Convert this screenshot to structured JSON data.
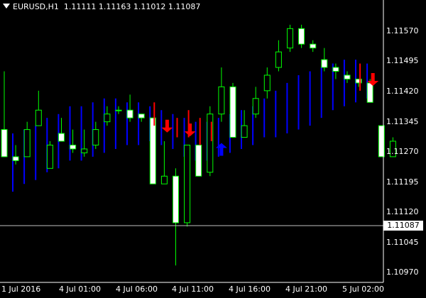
{
  "header": {
    "symbol_tf": "EURUSD,H1",
    "ohlc": "1.11111 1.11163 1.11012 1.11087"
  },
  "y_axis": {
    "labels": [
      "1.11570",
      "1.11495",
      "1.11420",
      "1.11345",
      "1.11270",
      "1.11195",
      "1.11120",
      "1.11045",
      "1.10970"
    ]
  },
  "current_price": "1.11087",
  "x_axis": {
    "labels": [
      "1 Jul 2016",
      "4 Jul 01:00",
      "4 Jul 06:00",
      "4 Jul 11:00",
      "4 Jul 16:00",
      "4 Jul 21:00",
      "5 Jul 02:00"
    ]
  },
  "colors": {
    "background": "#000000",
    "bull_border": "#00ff00",
    "bull_fill": "#000000",
    "bear_border": "#00ff00",
    "bear_fill": "#ffffff",
    "indicator": "#0000ff",
    "sell_arrow": "#ff0000",
    "buy_arrow": "#0000ff",
    "price_line": "#c0c0c0"
  },
  "chart_data": {
    "type": "candlestick",
    "ylim": [
      1.1094,
      1.1166
    ],
    "candles": [
      {
        "o": 1.1133,
        "h": 1.1148,
        "l": 1.1126,
        "c": 1.1126
      },
      {
        "o": 1.1126,
        "h": 1.1129,
        "l": 1.1124,
        "c": 1.1125
      },
      {
        "o": 1.1126,
        "h": 1.1135,
        "l": 1.1126,
        "c": 1.1133
      },
      {
        "o": 1.1134,
        "h": 1.1143,
        "l": 1.1134,
        "c": 1.1138
      },
      {
        "o": 1.1123,
        "h": 1.113,
        "l": 1.1123,
        "c": 1.1129
      },
      {
        "o": 1.1132,
        "h": 1.1136,
        "l": 1.113,
        "c": 1.113
      },
      {
        "o": 1.1129,
        "h": 1.1133,
        "l": 1.1127,
        "c": 1.1128
      },
      {
        "o": 1.1127,
        "h": 1.1133,
        "l": 1.1126,
        "c": 1.1128
      },
      {
        "o": 1.1129,
        "h": 1.1135,
        "l": 1.1128,
        "c": 1.1133
      },
      {
        "o": 1.1135,
        "h": 1.1139,
        "l": 1.1134,
        "c": 1.1137
      },
      {
        "o": 1.1138,
        "h": 1.1139,
        "l": 1.1137,
        "c": 1.1138
      },
      {
        "o": 1.1138,
        "h": 1.1142,
        "l": 1.1135,
        "c": 1.1136
      },
      {
        "o": 1.1137,
        "h": 1.1137,
        "l": 1.1135,
        "c": 1.1136
      },
      {
        "o": 1.1136,
        "h": 1.1136,
        "l": 1.1119,
        "c": 1.1119
      },
      {
        "o": 1.1119,
        "h": 1.113,
        "l": 1.1119,
        "c": 1.1121
      },
      {
        "o": 1.1121,
        "h": 1.1123,
        "l": 1.1098,
        "c": 1.1109
      },
      {
        "o": 1.1109,
        "h": 1.1129,
        "l": 1.1108,
        "c": 1.1129
      },
      {
        "o": 1.1129,
        "h": 1.1129,
        "l": 1.1121,
        "c": 1.1121
      },
      {
        "o": 1.1122,
        "h": 1.1139,
        "l": 1.1121,
        "c": 1.1137
      },
      {
        "o": 1.1137,
        "h": 1.1149,
        "l": 1.1135,
        "c": 1.1144
      },
      {
        "o": 1.1144,
        "h": 1.1145,
        "l": 1.1131,
        "c": 1.1131
      },
      {
        "o": 1.1131,
        "h": 1.1138,
        "l": 1.1131,
        "c": 1.1134
      },
      {
        "o": 1.1137,
        "h": 1.1144,
        "l": 1.1136,
        "c": 1.1141
      },
      {
        "o": 1.1143,
        "h": 1.1149,
        "l": 1.1141,
        "c": 1.1147
      },
      {
        "o": 1.1149,
        "h": 1.1156,
        "l": 1.1148,
        "c": 1.1153
      },
      {
        "o": 1.1154,
        "h": 1.116,
        "l": 1.1153,
        "c": 1.1159
      },
      {
        "o": 1.1159,
        "h": 1.116,
        "l": 1.1154,
        "c": 1.1155
      },
      {
        "o": 1.1155,
        "h": 1.1156,
        "l": 1.1153,
        "c": 1.1154
      },
      {
        "o": 1.1151,
        "h": 1.1154,
        "l": 1.1148,
        "c": 1.1149
      },
      {
        "o": 1.1149,
        "h": 1.115,
        "l": 1.1146,
        "c": 1.1148
      },
      {
        "o": 1.1147,
        "h": 1.1148,
        "l": 1.1145,
        "c": 1.1146
      },
      {
        "o": 1.1146,
        "h": 1.1146,
        "l": 1.1144,
        "c": 1.1145
      },
      {
        "o": 1.1145,
        "h": 1.1146,
        "l": 1.114,
        "c": 1.114
      },
      {
        "o": 1.1134,
        "h": 1.1134,
        "l": 1.1126,
        "c": 1.1126
      },
      {
        "o": 1.1126,
        "h": 1.1131,
        "l": 1.1126,
        "c": 1.113
      }
    ],
    "indicator": [
      {
        "high": 1.1132,
        "low": 1.1117
      },
      {
        "high": 1.1133,
        "low": 1.1119
      },
      {
        "high": 1.1134,
        "low": 1.112
      },
      {
        "high": 1.1136,
        "low": 1.1122
      },
      {
        "high": 1.1137,
        "low": 1.1123
      },
      {
        "high": 1.1139,
        "low": 1.1125
      },
      {
        "high": 1.1139,
        "low": 1.1125
      },
      {
        "high": 1.114,
        "low": 1.1126
      },
      {
        "high": 1.1141,
        "low": 1.1127
      },
      {
        "high": 1.1141,
        "low": 1.1128
      },
      {
        "high": 1.114,
        "low": 1.1129
      },
      {
        "high": 1.114,
        "low": 1.1129
      },
      {
        "high": 1.1139,
        "low": 1.113
      },
      {
        "high": 1.1138,
        "low": 1.1129
      },
      {
        "high": 1.1137,
        "low": 1.1128
      },
      {
        "high": 1.1136,
        "low": 1.1126
      },
      {
        "high": 1.1135,
        "low": 1.1125
      },
      {
        "high": 1.1135,
        "low": 1.1125
      },
      {
        "high": 1.1136,
        "low": 1.1126
      },
      {
        "high": 1.1137,
        "low": 1.1127
      },
      {
        "high": 1.1138,
        "low": 1.1128
      },
      {
        "high": 1.1139,
        "low": 1.1129
      },
      {
        "high": 1.1141,
        "low": 1.1131
      },
      {
        "high": 1.1143,
        "low": 1.1131
      },
      {
        "high": 1.1145,
        "low": 1.1132
      },
      {
        "high": 1.1147,
        "low": 1.1133
      },
      {
        "high": 1.1148,
        "low": 1.1134
      },
      {
        "high": 1.1149,
        "low": 1.1136
      },
      {
        "high": 1.115,
        "low": 1.1138
      },
      {
        "high": 1.1151,
        "low": 1.1139
      },
      {
        "high": 1.1151,
        "low": 1.114
      },
      {
        "high": 1.115,
        "low": 1.1141
      }
    ],
    "sell_signals": [
      {
        "bar": 14,
        "price": 1.1137
      },
      {
        "bar": 16,
        "price": 1.1136
      },
      {
        "bar": 32,
        "price": 1.1149
      }
    ],
    "sell_lines": [
      {
        "bar": 13,
        "high": 1.114,
        "low": 1.1134
      },
      {
        "bar": 15,
        "high": 1.1136,
        "low": 1.1131
      },
      {
        "bar": 16,
        "high": 1.1138,
        "low": 1.1131
      },
      {
        "bar": 17,
        "high": 1.1136,
        "low": 1.1129
      },
      {
        "bar": 18,
        "high": 1.1135,
        "low": 1.113
      },
      {
        "bar": 31,
        "high": 1.115,
        "low": 1.1143
      }
    ],
    "buy_signals": [
      {
        "bar": 19,
        "price": 1.1131
      }
    ]
  }
}
